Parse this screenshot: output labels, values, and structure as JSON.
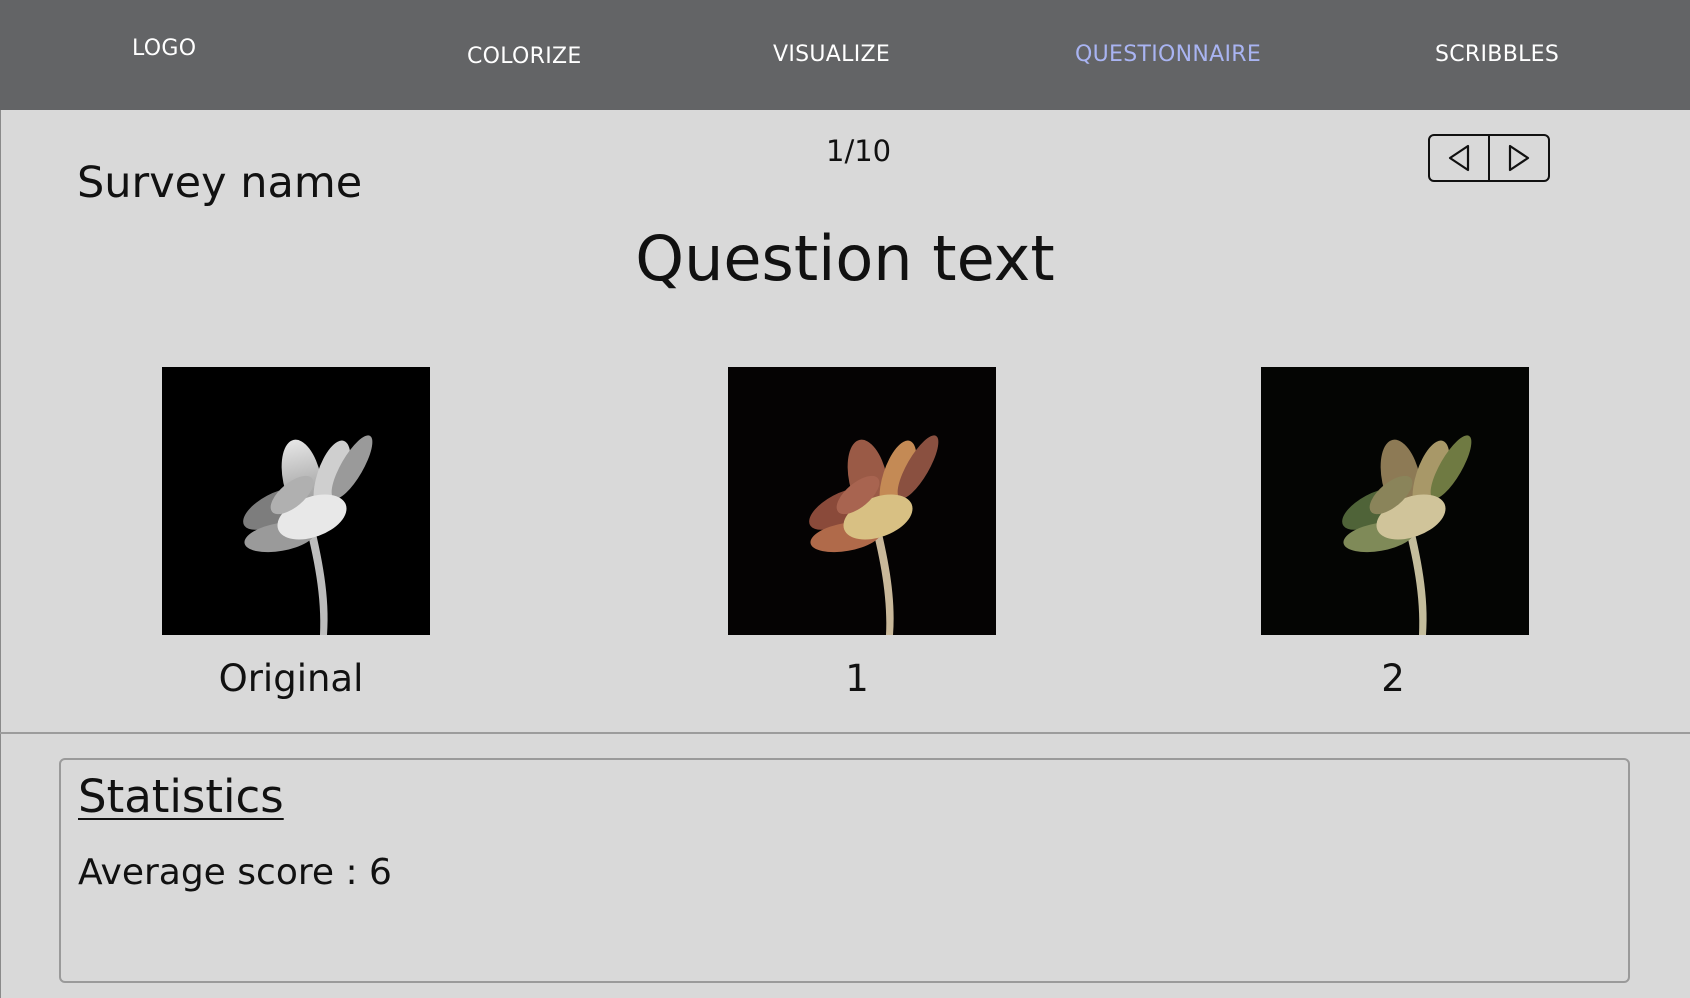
{
  "nav": {
    "logo": "LOGO",
    "items": [
      "COLORIZE",
      "VISUALIZE",
      "QUESTIONNAIRE",
      "SCRIBBLES"
    ],
    "active": "QUESTIONNAIRE",
    "active_color": "#a9b4f2",
    "background_color": "#636466"
  },
  "survey": {
    "name": "Survey name",
    "counter": "1/10",
    "question": "Question text"
  },
  "pager": {
    "prev_icon": "triangle-left-icon",
    "next_icon": "triangle-right-icon"
  },
  "images": [
    {
      "caption": "Original",
      "variant": "grayscale"
    },
    {
      "caption": "1",
      "variant": "warm-colorized"
    },
    {
      "caption": "2",
      "variant": "olive-colorized"
    }
  ],
  "statistics": {
    "title": "Statistics",
    "average_label": "Average score : 6"
  }
}
